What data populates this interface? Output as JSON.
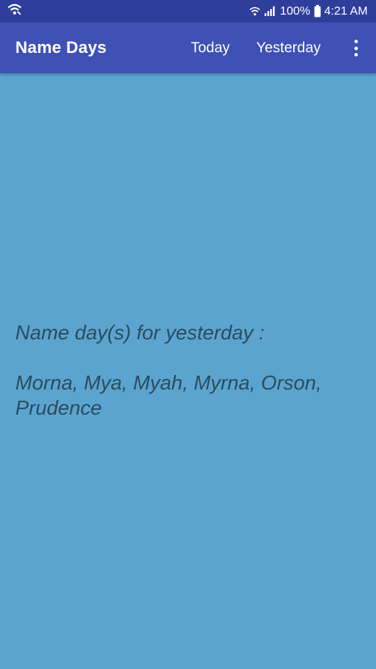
{
  "status_bar": {
    "battery": "100%",
    "time": "4:21 AM"
  },
  "app_bar": {
    "title": "Name Days",
    "actions": {
      "today": "Today",
      "yesterday": "Yesterday"
    }
  },
  "content": {
    "heading": "Name day(s) for yesterday :",
    "names": "Morna, Mya, Myah, Myrna, Orson, Prudence"
  },
  "colors": {
    "status_bar": "#2f3d9b",
    "app_bar": "#3f51b5",
    "background": "#5ba4cf",
    "text": "#2b4c5e"
  }
}
